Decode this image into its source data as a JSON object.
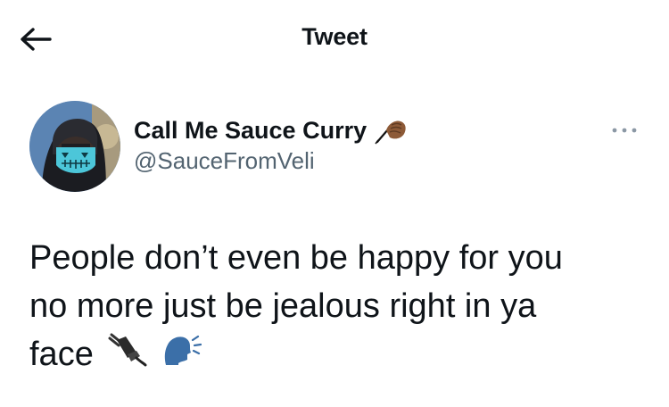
{
  "header": {
    "title": "Tweet",
    "back_icon": "arrow-left-icon"
  },
  "author": {
    "display_name": "Call Me Sauce Curry",
    "name_emoji": "writing-hand-emoji",
    "handle": "@SauceFromVeli",
    "more_icon": "more-horizontal-icon"
  },
  "tweet": {
    "text_line_1": "People don’t even be happy for you",
    "text_line_2": "no more just be jealous right in ya",
    "text_line_3": "face",
    "trailing_emojis": [
      "electric-plug-emoji",
      "speaking-head-emoji"
    ]
  },
  "colors": {
    "text_primary": "#0f1419",
    "text_secondary": "#536471",
    "background": "#ffffff"
  }
}
